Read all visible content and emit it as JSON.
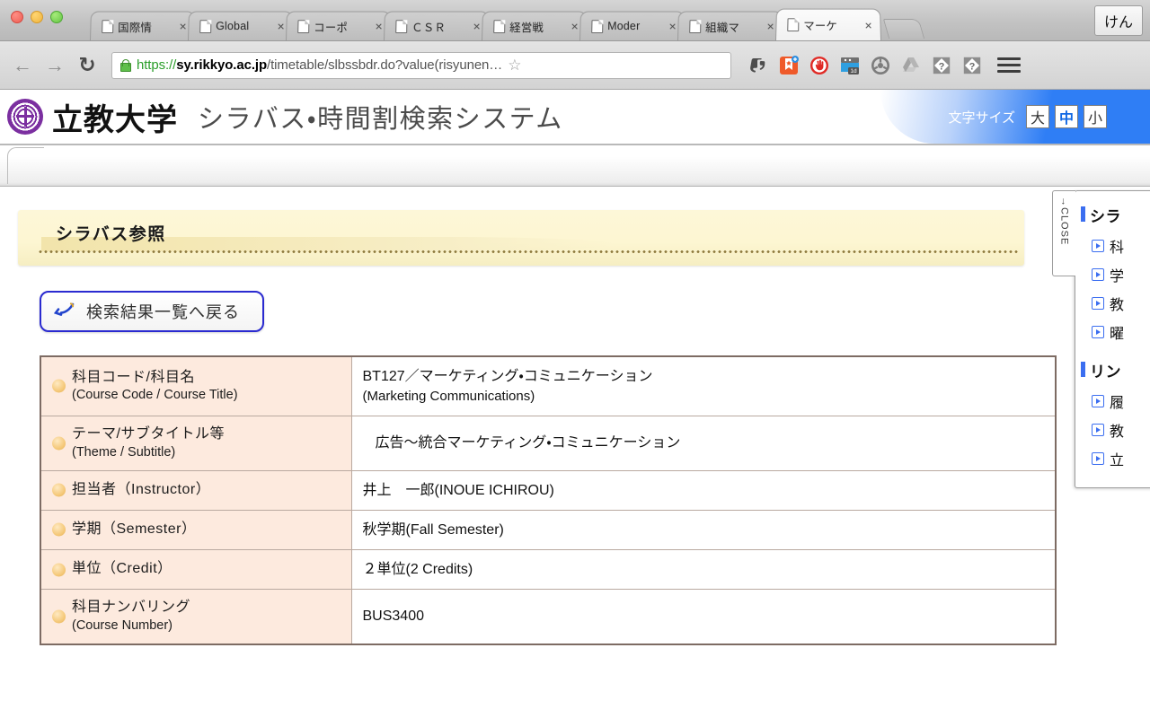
{
  "browser": {
    "tabs": [
      {
        "label": "国際情",
        "active": false
      },
      {
        "label": "Global",
        "active": false
      },
      {
        "label": "コーポ",
        "active": false
      },
      {
        "label": "ＣＳＲ",
        "active": false
      },
      {
        "label": "経営戦",
        "active": false
      },
      {
        "label": "Moder",
        "active": false
      },
      {
        "label": "組織マ",
        "active": false
      },
      {
        "label": "マーケ",
        "active": true
      }
    ],
    "close_glyph": "×",
    "new_tab_label": "",
    "profile_label": "けん",
    "back_glyph": "←",
    "forward_glyph": "→",
    "reload_glyph": "↻",
    "url": {
      "scheme": "https://",
      "host": "sy.rikkyo.ac.jp",
      "path": "/timetable/slbssbdr.do?value(risyunen…",
      "full": "https://sy.rikkyo.ac.jp/timetable/slbssbdr.do?value(risyunen…"
    },
    "star_glyph": "☆",
    "extensions": [
      "evernote-icon",
      "bookmark-add-icon",
      "adblock-icon",
      "onetab-icon",
      "steering-wheel-icon",
      "google-drive-icon",
      "diamond-question-icon",
      "diamond-question-icon-2"
    ],
    "menu_icon": "hamburger-menu-icon"
  },
  "site": {
    "university": "立教大学",
    "system_title": "シラバス・時間割検索システム",
    "crest": "rikkyo-crest-icon",
    "font_size": {
      "label": "文字サイズ",
      "options": [
        {
          "label": "大",
          "selected": false
        },
        {
          "label": "中",
          "selected": true
        },
        {
          "label": "小",
          "selected": false
        }
      ]
    }
  },
  "page": {
    "banner_title": "シラバス参照",
    "back_button": "検索結果一覧へ戻る"
  },
  "syllabus": {
    "rows": [
      {
        "label_jp": "科目コード/科目名",
        "label_en": "(Course Code / Course Title)",
        "value": "BT127／マーケティング・コミュニケーション",
        "value2": "(Marketing Communications)",
        "indent": false
      },
      {
        "label_jp": "テーマ/サブタイトル等",
        "label_en": "(Theme / Subtitle)",
        "value": "広告～統合マーケティング・コミュニケーション",
        "value2": "",
        "indent": true
      },
      {
        "label_jp": "担当者（Instructor）",
        "label_en": "",
        "value": "井上　一郎(INOUE ICHIROU)",
        "value2": "",
        "indent": false
      },
      {
        "label_jp": "学期（Semester）",
        "label_en": "",
        "value": "秋学期(Fall Semester)",
        "value2": "",
        "indent": false
      },
      {
        "label_jp": "単位（Credit）",
        "label_en": "",
        "value": "２単位(2 Credits)",
        "value2": "",
        "indent": false
      },
      {
        "label_jp": "科目ナンバリング",
        "label_en": "(Course Number)",
        "value": "BUS3400",
        "value2": "",
        "indent": false
      }
    ]
  },
  "side_panel": {
    "close_label": "→CLOSE",
    "sections": [
      {
        "heading": "シラ",
        "items": [
          "科",
          "学",
          "教",
          "曜"
        ]
      },
      {
        "heading": "リン",
        "items": [
          "履",
          "教",
          "立"
        ]
      }
    ]
  }
}
